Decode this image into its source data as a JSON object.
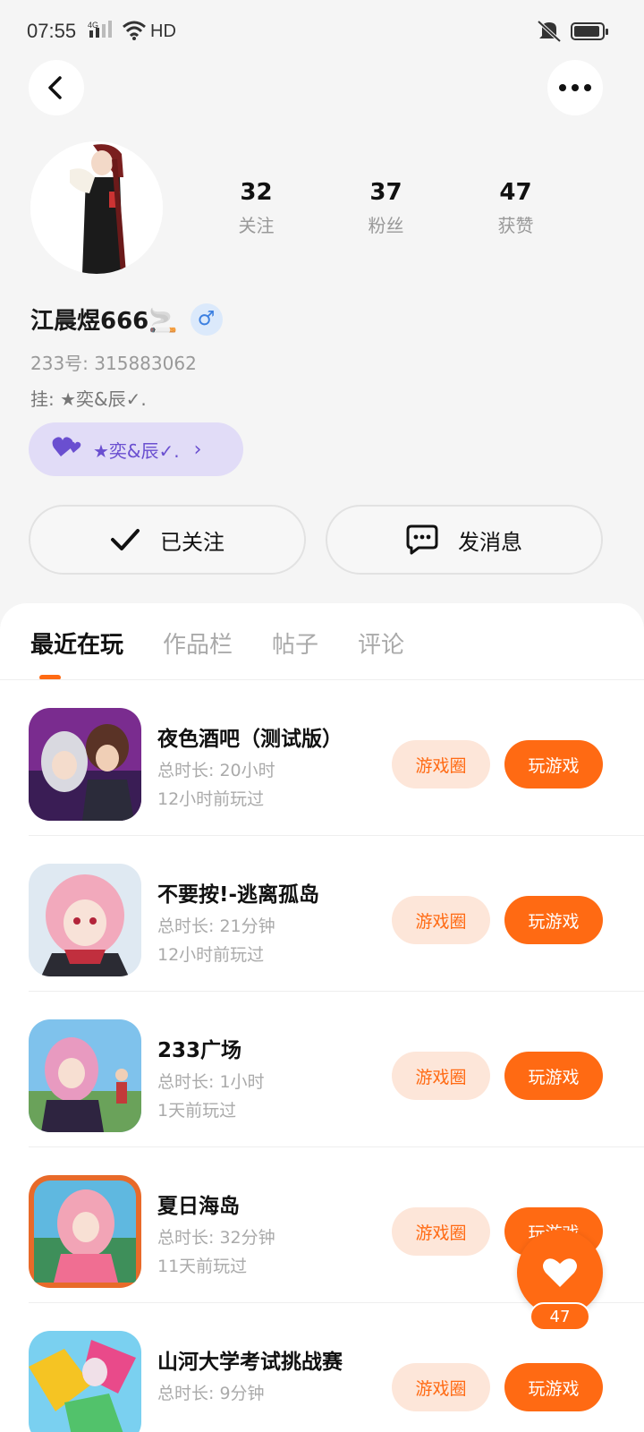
{
  "status_bar": {
    "time": "07:55",
    "signal": "4G",
    "network": "HD"
  },
  "profile": {
    "stats": [
      {
        "value": "32",
        "label": "关注"
      },
      {
        "value": "37",
        "label": "粉丝"
      },
      {
        "value": "47",
        "label": "获赞"
      }
    ],
    "username": "江晨煜666🚬",
    "gender_symbol": "♂",
    "uid": "233号: 315883062",
    "hang": "挂: ★奕&辰✓.",
    "family_label": "★奕&辰✓.",
    "family_arrow": "›"
  },
  "actions": {
    "follow_label": "已关注",
    "message_label": "发消息"
  },
  "tabs": [
    {
      "label": "最近在玩",
      "active": true
    },
    {
      "label": "作品栏",
      "active": false
    },
    {
      "label": "帖子",
      "active": false
    },
    {
      "label": "评论",
      "active": false
    }
  ],
  "games": [
    {
      "title": "夜色酒吧（测试版）",
      "duration": "总时长: 20小时",
      "last_played": "12小时前玩过",
      "circle_label": "游戏圈",
      "play_label": "玩游戏"
    },
    {
      "title": "不要按!-逃离孤岛",
      "duration": "总时长: 21分钟",
      "last_played": "12小时前玩过",
      "circle_label": "游戏圈",
      "play_label": "玩游戏"
    },
    {
      "title": "233广场",
      "duration": "总时长: 1小时",
      "last_played": "1天前玩过",
      "circle_label": "游戏圈",
      "play_label": "玩游戏"
    },
    {
      "title": "夏日海岛",
      "duration": "总时长: 32分钟",
      "last_played": "11天前玩过",
      "circle_label": "游戏圈",
      "play_label": "玩游戏"
    },
    {
      "title": "山河大学考试挑战赛",
      "duration": "总时长: 9分钟",
      "last_played": "",
      "circle_label": "游戏圈",
      "play_label": "玩游戏"
    }
  ],
  "like": {
    "count": "47"
  },
  "colors": {
    "accent": "#ff6a13",
    "accent_light": "#fde6d9",
    "family_chip": "#e1dcf7",
    "gender_badge": "#dbe9fb"
  }
}
